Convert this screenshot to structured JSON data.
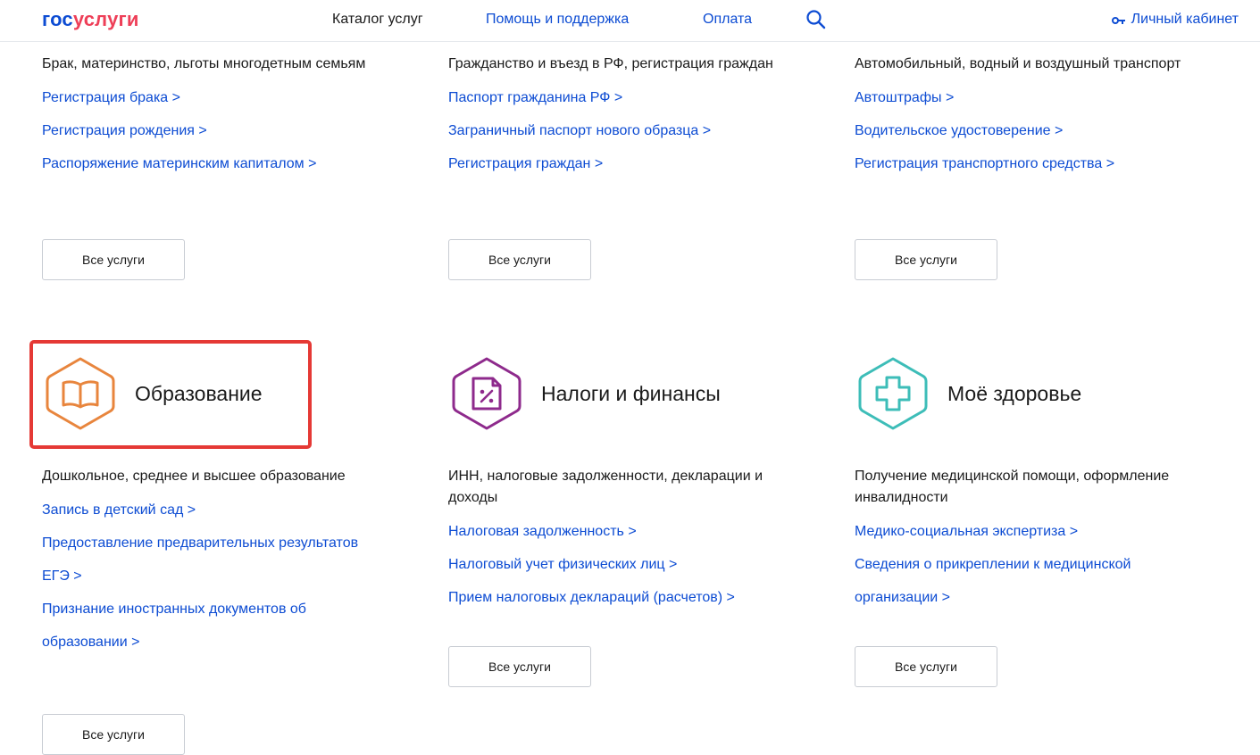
{
  "header": {
    "logo_part1": "гос",
    "logo_part2": "услуги",
    "nav": [
      "Каталог услуг",
      "Помощь и поддержка",
      "Оплата"
    ],
    "cabinet": "Личный кабинет"
  },
  "top_sections": [
    {
      "desc": "Брак, материнство, льготы многодетным семьям",
      "links": [
        "Регистрация брака >",
        "Регистрация рождения >",
        "Распоряжение материнским капиталом >"
      ],
      "button": "Все услуги"
    },
    {
      "desc": "Гражданство и въезд в РФ, регистрация граждан",
      "links": [
        "Паспорт гражданина РФ >",
        "Заграничный паспорт нового образца >",
        "Регистрация граждан >"
      ],
      "button": "Все услуги"
    },
    {
      "desc": "Автомобильный, водный и воздушный транспорт",
      "links": [
        "Автоштрафы >",
        "Водительское удостоверение >",
        "Регистрация транспортного средства >"
      ],
      "button": "Все услуги"
    }
  ],
  "bottom_sections": [
    {
      "title": "Образование",
      "icon": "book-icon",
      "color": "#e8853d",
      "desc": "Дошкольное, среднее и высшее образование",
      "links": [
        "Запись в детский сад >",
        "Предоставление предварительных результатов ЕГЭ >",
        "Признание иностранных документов об образовании >"
      ],
      "button": "Все услуги"
    },
    {
      "title": "Налоги и финансы",
      "icon": "tax-document-icon",
      "color": "#8e2a8c",
      "desc": "ИНН, налоговые задолженности, декларации и доходы",
      "links": [
        "Налоговая задолженность >",
        "Налоговый учет физических лиц >",
        "Прием налоговых деклараций (расчетов) >"
      ],
      "button": "Все услуги"
    },
    {
      "title": "Моё здоровье",
      "icon": "medical-cross-icon",
      "color": "#3dbdb8",
      "desc": "Получение медицинской помощи, оформление инвалидности",
      "links": [
        "Медико-социальная экспертиза >",
        "Сведения о прикреплении к медицинской организации >"
      ],
      "button": "Все услуги"
    }
  ],
  "highlight_color": "#e53935"
}
